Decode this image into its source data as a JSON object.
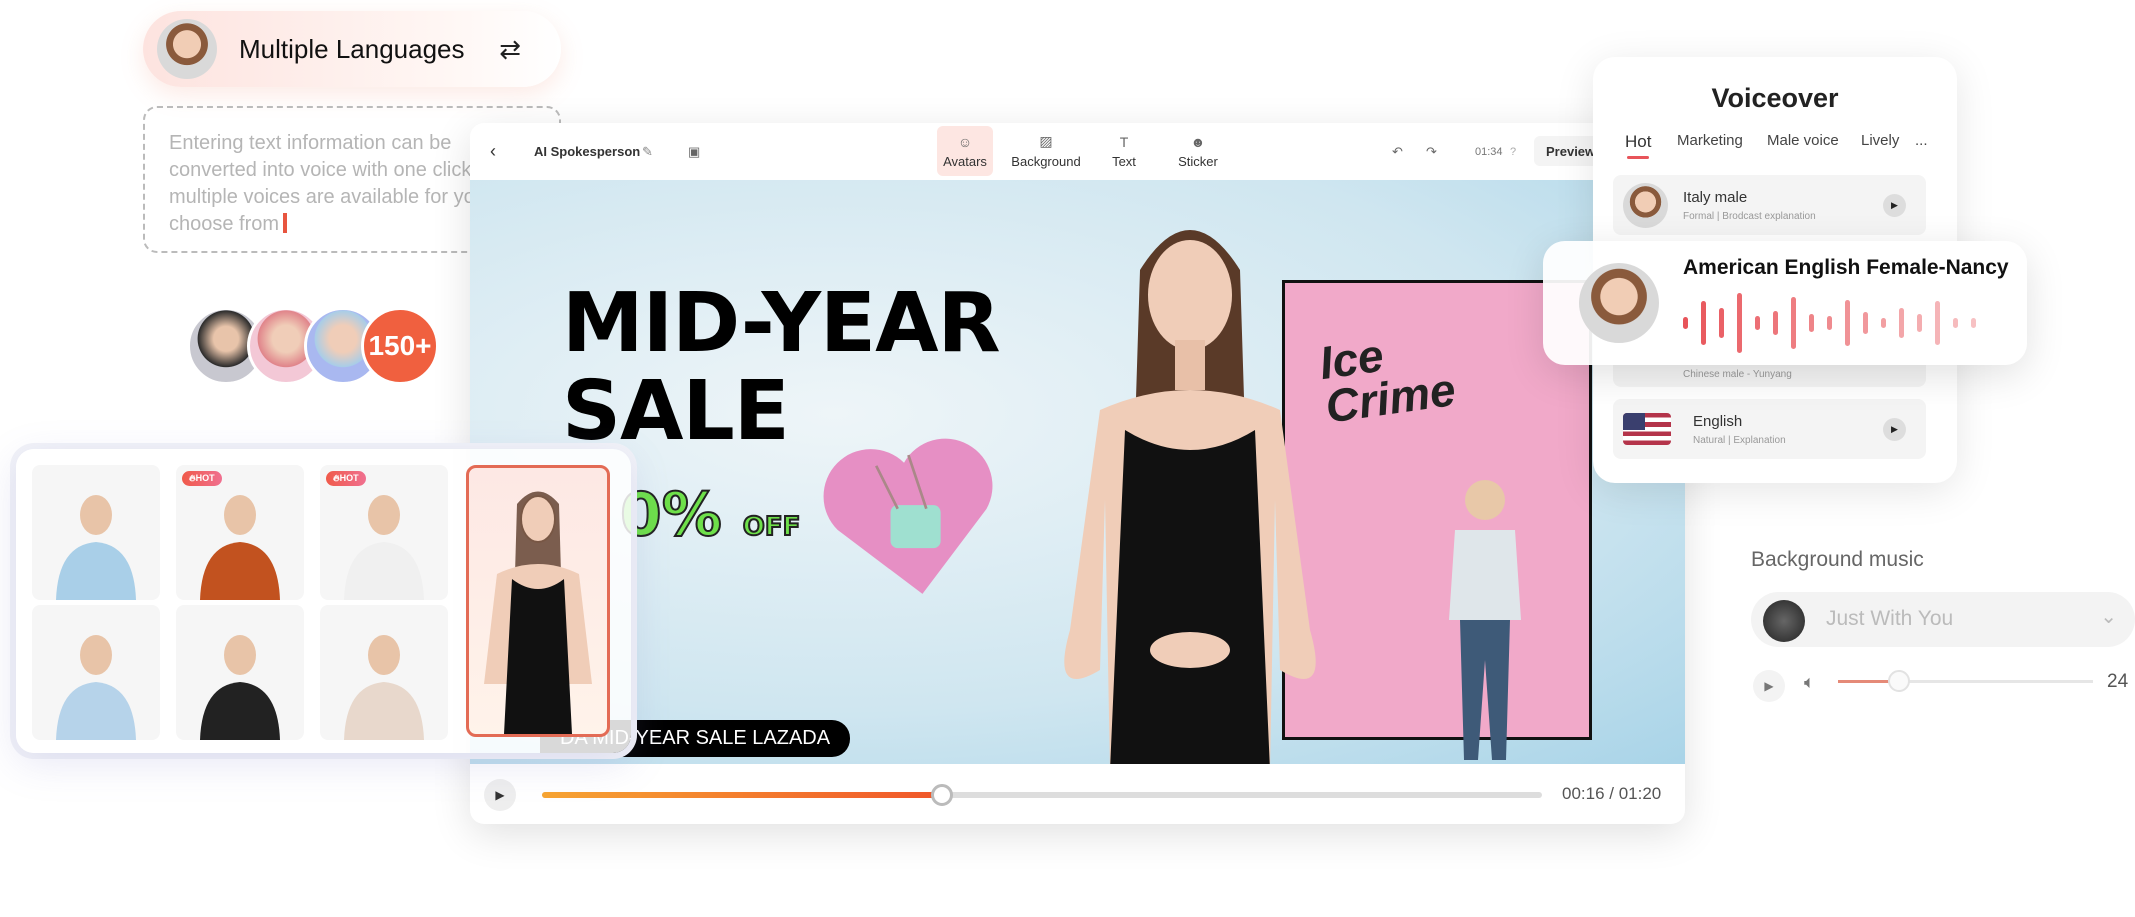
{
  "languages": {
    "title": "Multiple Languages",
    "icon": "repeat-icon"
  },
  "text_input": {
    "value": "Entering text information can be converted into voice with one click, multiple voices are available for you to choose from"
  },
  "avatar_count": "150+",
  "editor": {
    "project_name": "AI Spokesperson",
    "tools": [
      {
        "label": "Avatars",
        "icon": "avatar-icon",
        "active": true
      },
      {
        "label": "Background",
        "icon": "background-icon"
      },
      {
        "label": "Text",
        "icon": "text-icon"
      },
      {
        "label": "Sticker",
        "icon": "sticker-icon"
      }
    ],
    "duration": "01:34",
    "preview_label": "Preview",
    "canvas": {
      "headline": "MID-YEAR SALE",
      "discount": "0%",
      "discount_suffix": "OFF",
      "sign": "Ice Crime",
      "ticker": "DA MID-YEAR SALE LAZADA"
    },
    "playback": {
      "time": "00:16 / 01:20",
      "progress": 0.4
    }
  },
  "avatar_grid": {
    "hot_label": "HOT",
    "hot_flags": [
      false,
      true,
      true,
      false,
      false,
      false
    ]
  },
  "voiceover": {
    "title": "Voiceover",
    "tabs": [
      "Hot",
      "Marketing",
      "Male voice",
      "Lively",
      "..."
    ],
    "active_tab": "Hot",
    "voices": [
      {
        "name": "Italy male",
        "desc": "Formal | Brodcast explanation"
      },
      {
        "name": "",
        "desc": "Chinese male - Yunyang"
      },
      {
        "name": "English",
        "desc": "Natural | Explanation"
      }
    ],
    "featured": "American English Female-Nancy"
  },
  "background_music": {
    "title": "Background music",
    "track": "Just With You",
    "volume": "24",
    "volume_level": 0.24
  },
  "colors": {
    "accent": "#f0603f",
    "wave": "#e8545a",
    "selected_border": "#e36b55",
    "discount": "#6ee04a"
  }
}
